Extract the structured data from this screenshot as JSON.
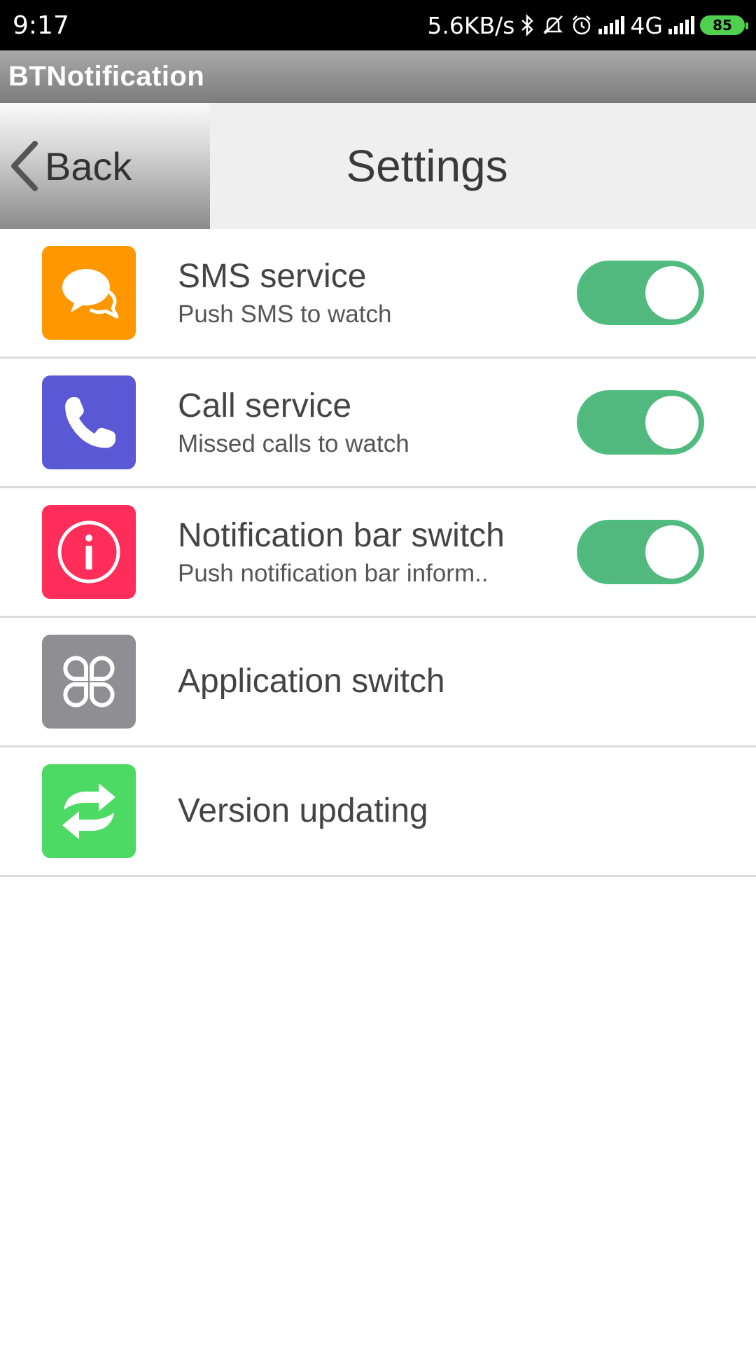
{
  "status_bar": {
    "time": "9:17",
    "net_speed": "5.6KB/s",
    "network_type": "4G",
    "battery_level": "85",
    "icons": [
      "bluetooth-icon",
      "mute-icon",
      "alarm-icon",
      "signal-icon",
      "signal-icon",
      "battery-icon"
    ]
  },
  "app_bar": {
    "title": "BTNotification"
  },
  "header": {
    "back_label": "Back",
    "title": "Settings"
  },
  "colors": {
    "sms": "#ff9800",
    "call": "#5b58d6",
    "notification": "#ff2d5a",
    "application": "#8e8e93",
    "version": "#4cd964",
    "toggle_on": "#52b97e"
  },
  "settings": [
    {
      "title": "SMS service",
      "subtitle": "Push SMS to watch",
      "icon": "chat-bubbles-icon",
      "toggle": true
    },
    {
      "title": "Call service",
      "subtitle": "Missed calls to watch",
      "icon": "phone-icon",
      "toggle": true
    },
    {
      "title": "Notification bar switch",
      "subtitle": "Push notification bar inform..",
      "icon": "info-icon",
      "toggle": true
    },
    {
      "title": "Application switch",
      "icon": "apps-icon"
    },
    {
      "title": "Version updating",
      "icon": "refresh-icon"
    }
  ]
}
